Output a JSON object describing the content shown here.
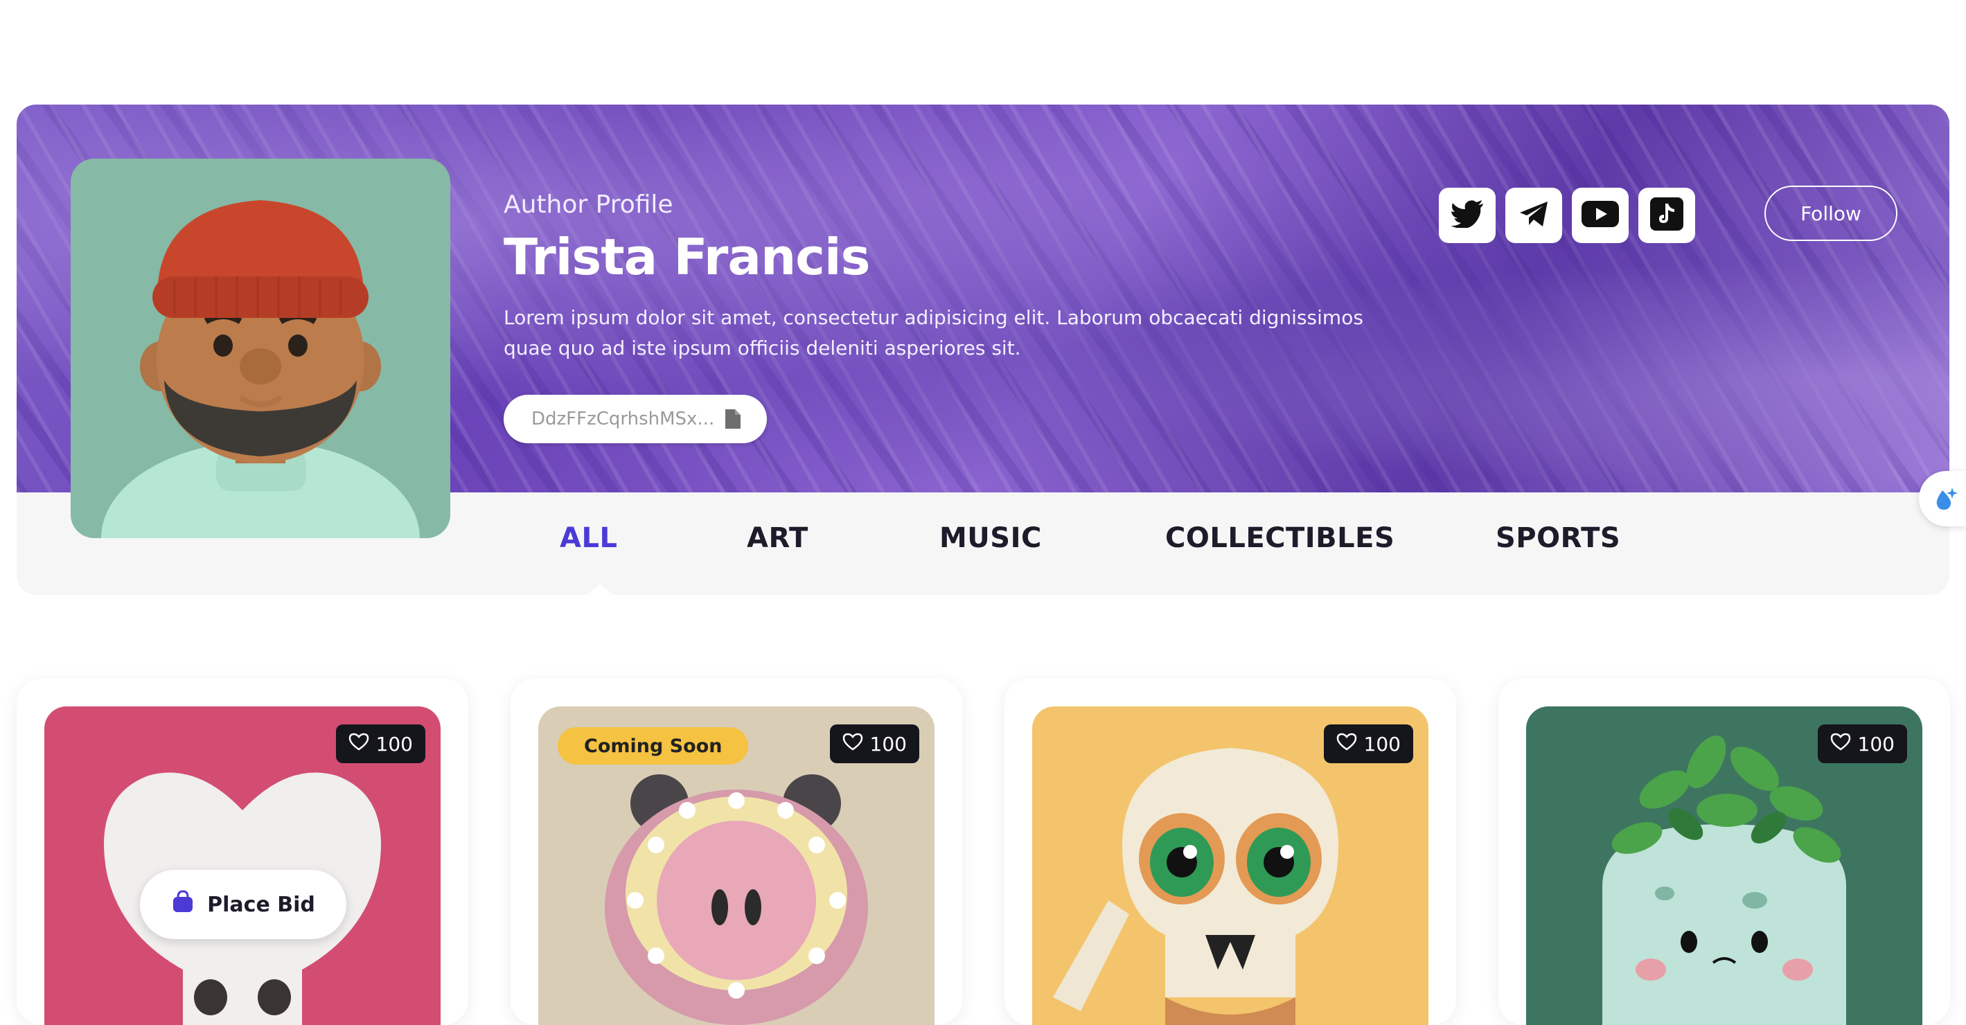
{
  "profile": {
    "label": "Author Profile",
    "name": "Trista Francis",
    "bio": "Lorem ipsum dolor sit amet, consectetur adipisicing elit. Laborum obcaecati dignissimos quae quo ad iste ipsum officiis deleniti asperiores sit.",
    "wallet": "DdzFFzCqrhshMSx..."
  },
  "social": [
    {
      "icon": "twitter-icon"
    },
    {
      "icon": "telegram-icon"
    },
    {
      "icon": "youtube-icon"
    },
    {
      "icon": "tiktok-icon"
    }
  ],
  "follow_label": "Follow",
  "tabs": [
    {
      "label": "ALL",
      "active": true
    },
    {
      "label": "ART",
      "active": false
    },
    {
      "label": "MUSIC",
      "active": false
    },
    {
      "label": "COLLECTIBLES",
      "active": false
    },
    {
      "label": "SPORTS",
      "active": false
    }
  ],
  "cards": [
    {
      "likes": "100",
      "bg": "#d34d72",
      "bid_label": "Place Bid"
    },
    {
      "likes": "100",
      "bg": "#d9cdb6",
      "badge": "Coming Soon"
    },
    {
      "likes": "100",
      "bg": "#f3c46b"
    },
    {
      "likes": "100",
      "bg": "#3e7560"
    }
  ],
  "colors": {
    "accent": "#4b3ad6",
    "badge": "#f5c242",
    "like_bg": "#15151c"
  }
}
